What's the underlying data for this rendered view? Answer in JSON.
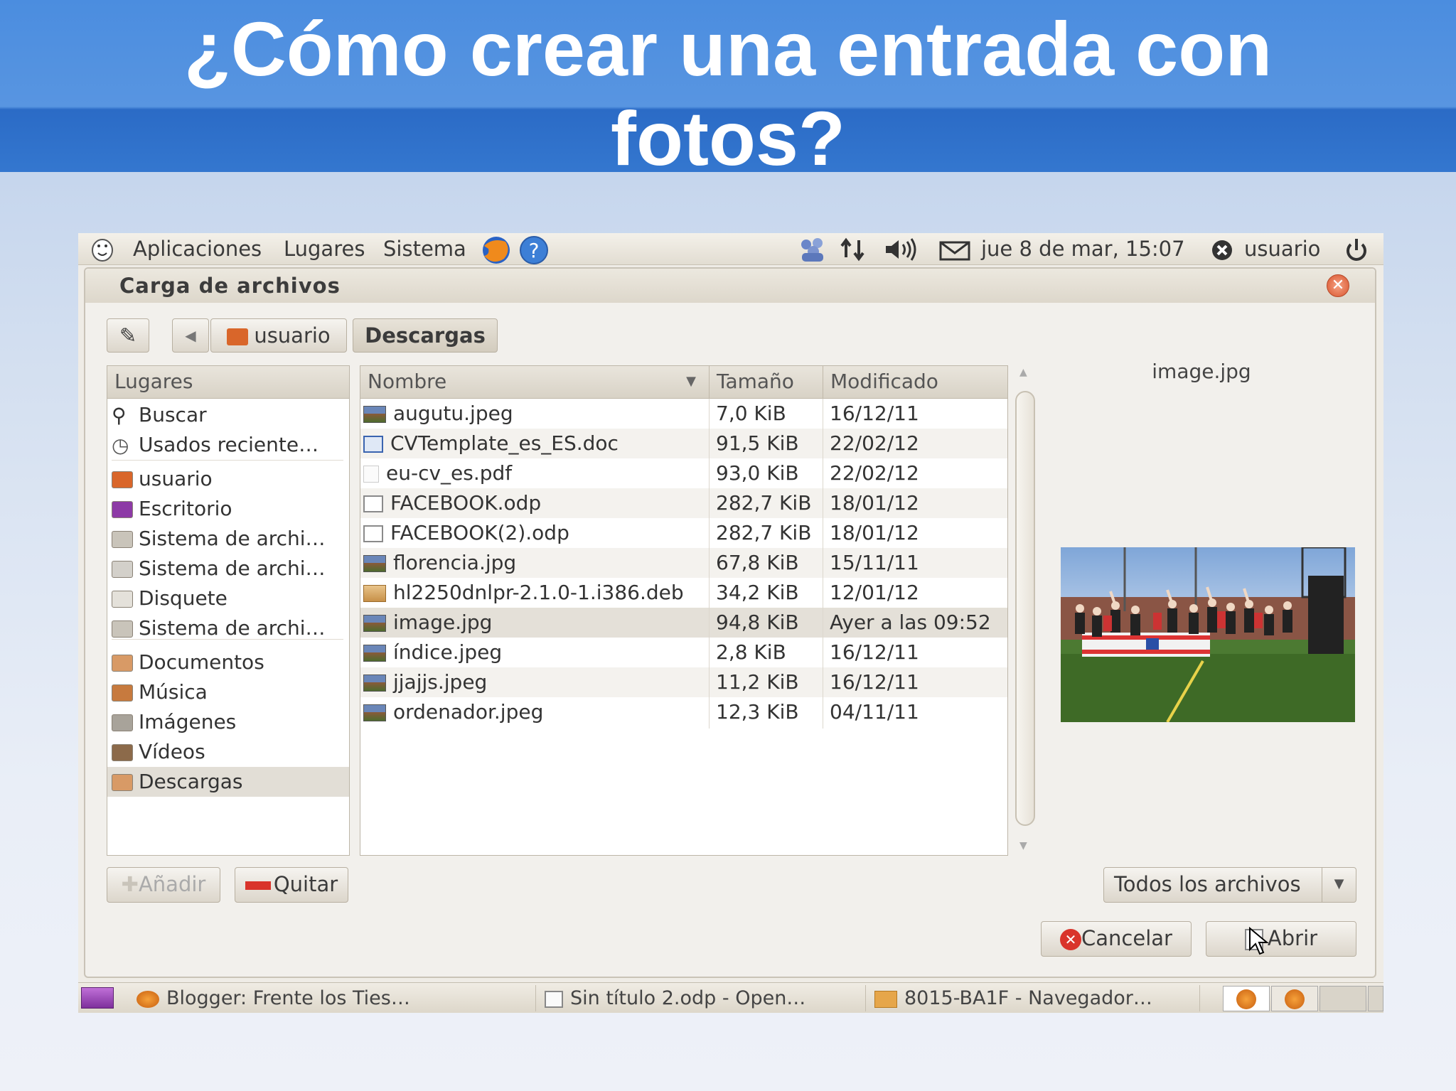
{
  "slide": {
    "title_line1": "¿Cómo crear una entrada con",
    "title_line2": "fotos?"
  },
  "top_panel": {
    "menus": [
      "Aplicaciones",
      "Lugares",
      "Sistema"
    ],
    "clock": "jue   8 de mar, 15:07",
    "user": "usuario"
  },
  "dialog": {
    "title": "Carga de archivos",
    "path": [
      "usuario",
      "Descargas"
    ],
    "places_header": "Lugares",
    "places": [
      {
        "label": "Buscar",
        "icon": "search-icon"
      },
      {
        "label": "Usados reciente…",
        "icon": "recent-icon"
      },
      {
        "label": "usuario",
        "icon": "home-folder-icon"
      },
      {
        "label": "Escritorio",
        "icon": "desktop-icon"
      },
      {
        "label": "Sistema de archi…",
        "icon": "drive-icon"
      },
      {
        "label": "Sistema de archi…",
        "icon": "usb-drive-icon"
      },
      {
        "label": "Disquete",
        "icon": "floppy-icon"
      },
      {
        "label": "Sistema de archi…",
        "icon": "drive-icon"
      },
      {
        "label": "Documentos",
        "icon": "documents-folder-icon"
      },
      {
        "label": "Música",
        "icon": "music-folder-icon"
      },
      {
        "label": "Imágenes",
        "icon": "pictures-folder-icon"
      },
      {
        "label": "Vídeos",
        "icon": "videos-folder-icon"
      },
      {
        "label": "Descargas",
        "icon": "downloads-folder-icon"
      }
    ],
    "selected_place": "Descargas",
    "columns": {
      "name": "Nombre",
      "size": "Tamaño",
      "modified": "Modificado"
    },
    "files": [
      {
        "name": "augutu.jpeg",
        "size": "7,0 KiB",
        "modified": "16/12/11",
        "icon": "image-thumb-icon"
      },
      {
        "name": "CVTemplate_es_ES.doc",
        "size": "91,5 KiB",
        "modified": "22/02/12",
        "icon": "word-doc-icon"
      },
      {
        "name": "eu-cv_es.pdf",
        "size": "93,0 KiB",
        "modified": "22/02/12",
        "icon": "pdf-icon"
      },
      {
        "name": "FACEBOOK.odp",
        "size": "282,7 KiB",
        "modified": "18/01/12",
        "icon": "presentation-icon"
      },
      {
        "name": "FACEBOOK(2).odp",
        "size": "282,7 KiB",
        "modified": "18/01/12",
        "icon": "presentation-icon"
      },
      {
        "name": "florencia.jpg",
        "size": "67,8 KiB",
        "modified": "15/11/11",
        "icon": "image-thumb-icon"
      },
      {
        "name": "hl2250dnlpr-2.1.0-1.i386.deb",
        "size": "34,2 KiB",
        "modified": "12/01/12",
        "icon": "package-icon"
      },
      {
        "name": "image.jpg",
        "size": "94,8 KiB",
        "modified": "Ayer a las 09:52",
        "icon": "image-thumb-icon"
      },
      {
        "name": "índice.jpeg",
        "size": "2,8 KiB",
        "modified": "16/12/11",
        "icon": "image-thumb-icon"
      },
      {
        "name": "jjajjs.jpeg",
        "size": "11,2 KiB",
        "modified": "16/12/11",
        "icon": "image-thumb-icon"
      },
      {
        "name": "ordenador.jpeg",
        "size": "12,3 KiB",
        "modified": "04/11/11",
        "icon": "image-thumb-icon"
      }
    ],
    "selected_file": "image.jpg",
    "preview_name": "image.jpg",
    "add_label": "Añadir",
    "remove_label": "Quitar",
    "filter_label": "Todos los archivos",
    "cancel_label": "Cancelar",
    "open_label": "Abrir"
  },
  "taskbar": {
    "tasks": [
      "Blogger: Frente los Ties…",
      "Sin título 2.odp - Open…",
      "8015-BA1F - Navegador…"
    ]
  },
  "colors": {
    "banner": "#3477cf",
    "selection": "#e4e0d8",
    "cancel_red": "#d9342b"
  }
}
